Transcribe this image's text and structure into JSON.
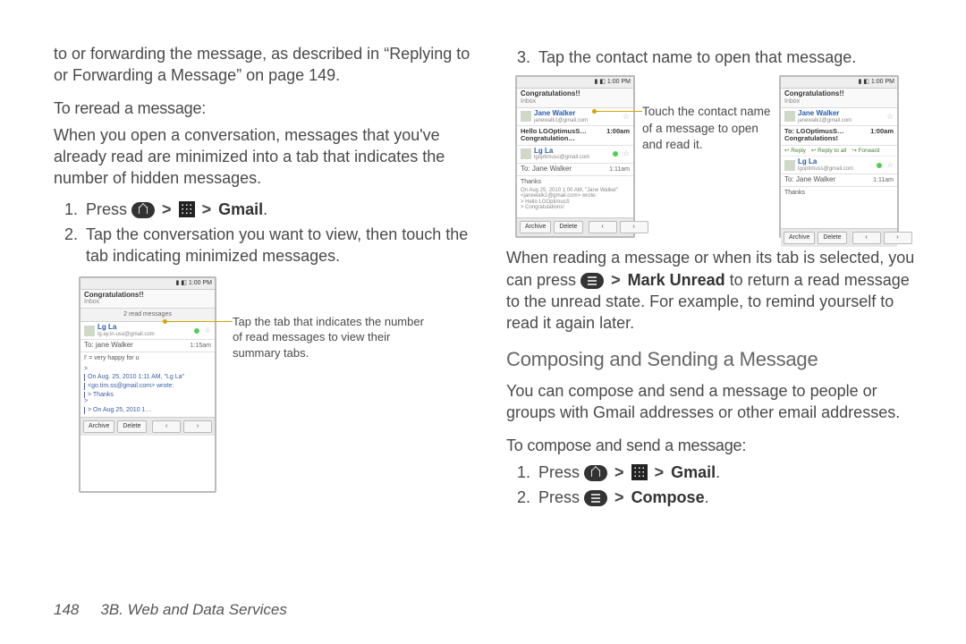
{
  "left": {
    "intro": "to or forwarding the message, as described in “Replying to or Forwarding a Message” on page 149.",
    "subhead": "To reread a message:",
    "para": "When you open a conversation, messages that you've already read are minimized into a tab that indicates the number of hidden messages.",
    "step1_a": "Press ",
    "step1_b": "Gmail",
    "step1_c": ".",
    "step2": "Tap the conversation you want to view, then touch the tab indicating minimized messages.",
    "callout": "Tap the tab that indicates the number of read messages to view their summary tabs."
  },
  "right": {
    "step3": "Tap the contact name to open that message.",
    "callout": "Touch the contact name of a message to open and read it.",
    "read_a": "When reading a message or when its tab is selected, you can press ",
    "read_b": "Mark Unread",
    "read_c": " to return a read message to the unread state. For example, to remind yourself to read it again later.",
    "h2": "Composing and Sending a Message",
    "compose_intro": "You can compose and send a message to people or groups with Gmail addresses or other email addresses.",
    "compose_sub": "To compose and send a message:",
    "c1_a": "Press ",
    "c1_b": "Gmail",
    "c1_c": ".",
    "c2_a": "Press ",
    "c2_b": "Compose",
    "c2_c": "."
  },
  "phone_common": {
    "time": "1:00 PM",
    "title": "Congratulations!!",
    "sub": "Inbox",
    "archive": "Archive",
    "delete": "Delete"
  },
  "phone_a": {
    "tab": "2 read messages",
    "name": "Lg La",
    "mail": "lg.ay.in-usa@gmail.com",
    "to": "To: jane Walker",
    "t": "1:15am",
    "body": "I' = very happy for u",
    "q1": "On Aug. 25, 2010 1:11 AM, \"Lg La\"",
    "q2": "<go.tim.ss@gmail.com> wrote:",
    "q3": "Thanks",
    "q4": "On Aug 25, 2010 1…"
  },
  "phone_b": {
    "name": "Jane Walker",
    "mail": "janewalk1@gmail.com",
    "hello": "Hello LGOptimusS… Congratulation…",
    "t1": "1:00am",
    "name2": "Lg La",
    "mail2": "lgoptimuss@gmail.com",
    "to2": "To: Jane Walker",
    "t2": "1:11am",
    "body": "Thanks",
    "q1": "On Aug 25, 2010 1:00 AM, \"Jane Walker\"",
    "q2": "<janewalk1@gmail.com> wrote:",
    "q3": "Hello LGOptimusS",
    "q4": "Congratulations!"
  },
  "phone_c": {
    "name": "Jane Walker",
    "mail": "janewalk1@gmail.com",
    "to": "To: LGOptimusS…",
    "sub2": "Congratulations!",
    "t1": "1:00am",
    "a1": "Reply",
    "a2": "Reply to all",
    "a3": "Forward",
    "name2": "Lg La",
    "mail2": "lgoptimuss@gmail.com",
    "to2": "To: Jane Walker",
    "t2": "1:11am",
    "body": "Thanks"
  },
  "footer": {
    "num": "148",
    "section": "3B. Web and Data Services"
  }
}
